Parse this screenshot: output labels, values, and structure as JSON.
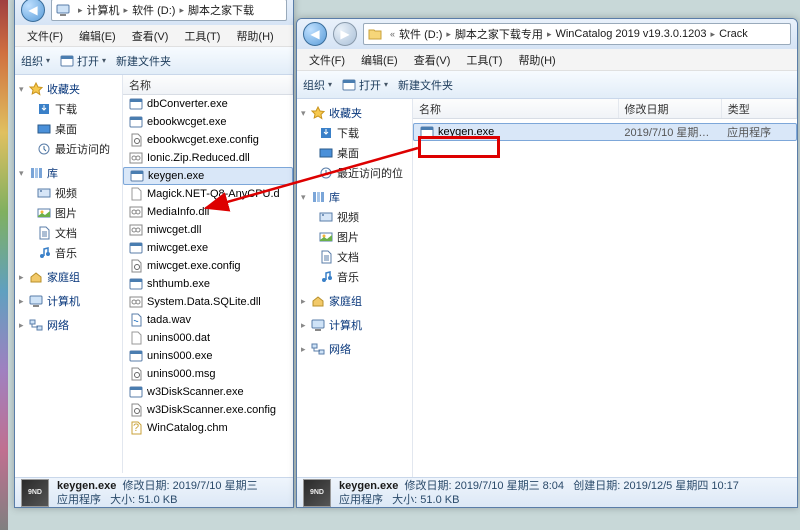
{
  "menu": [
    "文件(F)",
    "编辑(E)",
    "查看(V)",
    "工具(T)",
    "帮助(H)"
  ],
  "toolbar": {
    "organize": "组织",
    "open": "打开",
    "newfolder": "新建文件夹"
  },
  "nav": {
    "favorites": "收藏夹",
    "downloads": "下载",
    "desktop": "桌面",
    "recent": "最近访问的",
    "recent_s": "最近访问的位",
    "libraries": "库",
    "videos": "视频",
    "pictures": "图片",
    "documents": "文档",
    "music": "音乐",
    "homegroup": "家庭组",
    "computer": "计算机",
    "network": "网络"
  },
  "columns": {
    "name": "名称",
    "modified": "修改日期",
    "type": "类型"
  },
  "win1": {
    "addr": {
      "computer": "计算机",
      "drive": "软件 (D:)",
      "folder": "脚本之家下载"
    },
    "files": [
      "dbConverter.exe",
      "ebookwcget.exe",
      "ebookwcget.exe.config",
      "Ionic.Zip.Reduced.dll",
      "keygen.exe",
      "Magick.NET-Q8-AnyCPU.d",
      "MediaInfo.dll",
      "miwcget.dll",
      "miwcget.exe",
      "miwcget.exe.config",
      "shthumb.exe",
      "System.Data.SQLite.dll",
      "tada.wav",
      "unins000.dat",
      "unins000.exe",
      "unins000.msg",
      "w3DiskScanner.exe",
      "w3DiskScanner.exe.config",
      "WinCatalog.chm"
    ],
    "detail": {
      "name": "keygen.exe",
      "mod_l": "修改日期:",
      "mod": "2019/7/10 星期三",
      "type_l": "应用程序",
      "size_l": "大小:",
      "size": "51.0 KB"
    }
  },
  "win2": {
    "addr": {
      "drive": "软件 (D:)",
      "f1": "脚本之家下载专用",
      "f2": "WinCatalog 2019 v19.3.0.1203",
      "f3": "Crack"
    },
    "file": {
      "name": "keygen.exe",
      "mod": "2019/7/10 星期…",
      "type": "应用程序"
    },
    "detail": {
      "name": "keygen.exe",
      "mod_l": "修改日期:",
      "mod": "2019/7/10 星期三 8:04",
      "created_l": "创建日期:",
      "created": "2019/12/5 星期四 10:17",
      "type_l": "应用程序",
      "size_l": "大小:",
      "size": "51.0 KB"
    }
  }
}
